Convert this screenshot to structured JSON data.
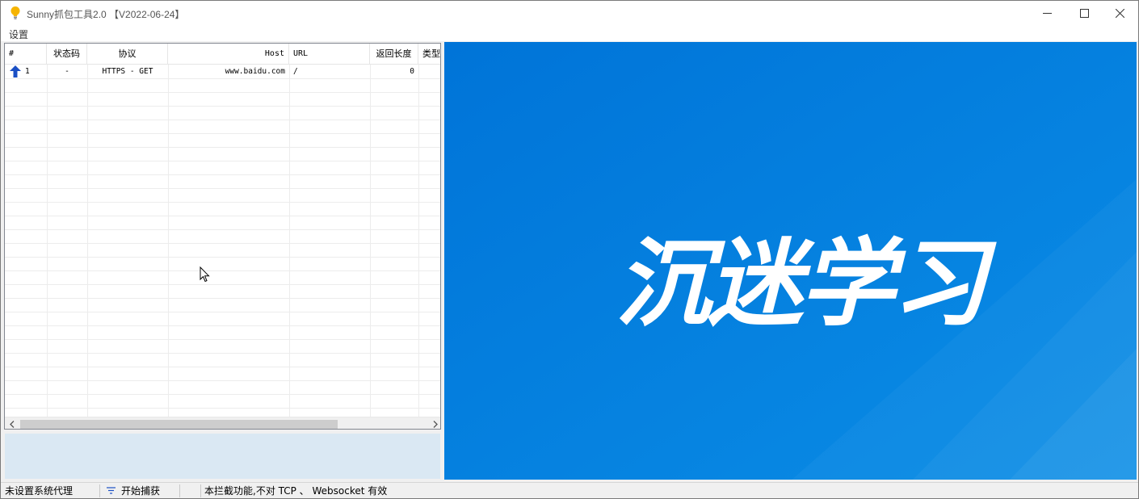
{
  "window": {
    "title": "Sunny抓包工具2.0 【V2022-06-24】",
    "app_icon": "lightbulb-icon",
    "controls": [
      "minimize-icon",
      "maximize-icon",
      "close-icon"
    ]
  },
  "menu": {
    "settings": "设置"
  },
  "table": {
    "columns": [
      "#",
      "状态码",
      "协议",
      "Host",
      "URL",
      "返回长度",
      "类型"
    ],
    "rows": [
      {
        "icon": "upload-arrow-icon",
        "num": "1",
        "status": "-",
        "protocol": "HTTPS - GET",
        "host": "www.baidu.com",
        "url": "/",
        "length": "0",
        "type": ""
      }
    ]
  },
  "preview": {
    "image_text": "沉迷学习",
    "background_color": "#0079db"
  },
  "statusbar": {
    "proxy": "未设置系统代理",
    "capture": "开始捕获",
    "notice": "本拦截功能,不对 TCP 、 Websocket 有效"
  },
  "colors": {
    "accent_blue": "#0079db",
    "detail_panel": "#dae8f3",
    "arrow_blue": "#1a4fc4"
  }
}
